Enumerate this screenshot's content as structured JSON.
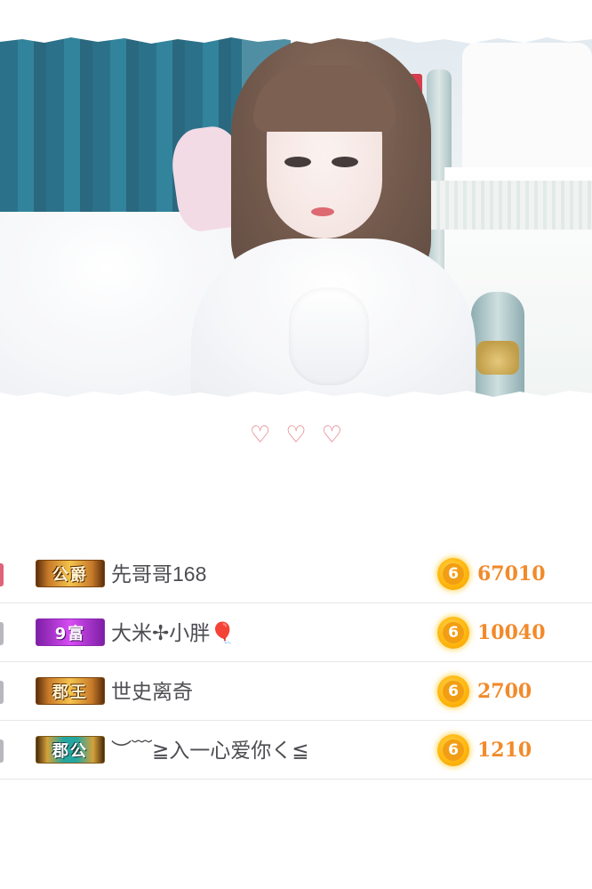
{
  "stream": {
    "image_desc_icon": "streamer-photo"
  },
  "hearts": [
    "♡",
    "♡",
    "♡"
  ],
  "colors": {
    "heart": "#e0737c",
    "amount": "#f28a2a",
    "coin": "#ffb80f",
    "divider": "#e7e7ea"
  },
  "leaderboard": {
    "rows": [
      {
        "badge": "公爵",
        "badge_style": "gold",
        "name": "先哥哥168",
        "coin_glyph": "6",
        "amount": "67010"
      },
      {
        "badge": "9富",
        "badge_style": "purple",
        "name": "大米✢小胖🎈",
        "coin_glyph": "6",
        "amount": "10040"
      },
      {
        "badge": "郡王",
        "badge_style": "gold",
        "name": "世史离奇",
        "coin_glyph": "6",
        "amount": "2700"
      },
      {
        "badge": "郡公",
        "badge_style": "teal",
        "name": "︶﹋≧入一心爱你く≦",
        "coin_glyph": "6",
        "amount": "1210"
      }
    ]
  }
}
